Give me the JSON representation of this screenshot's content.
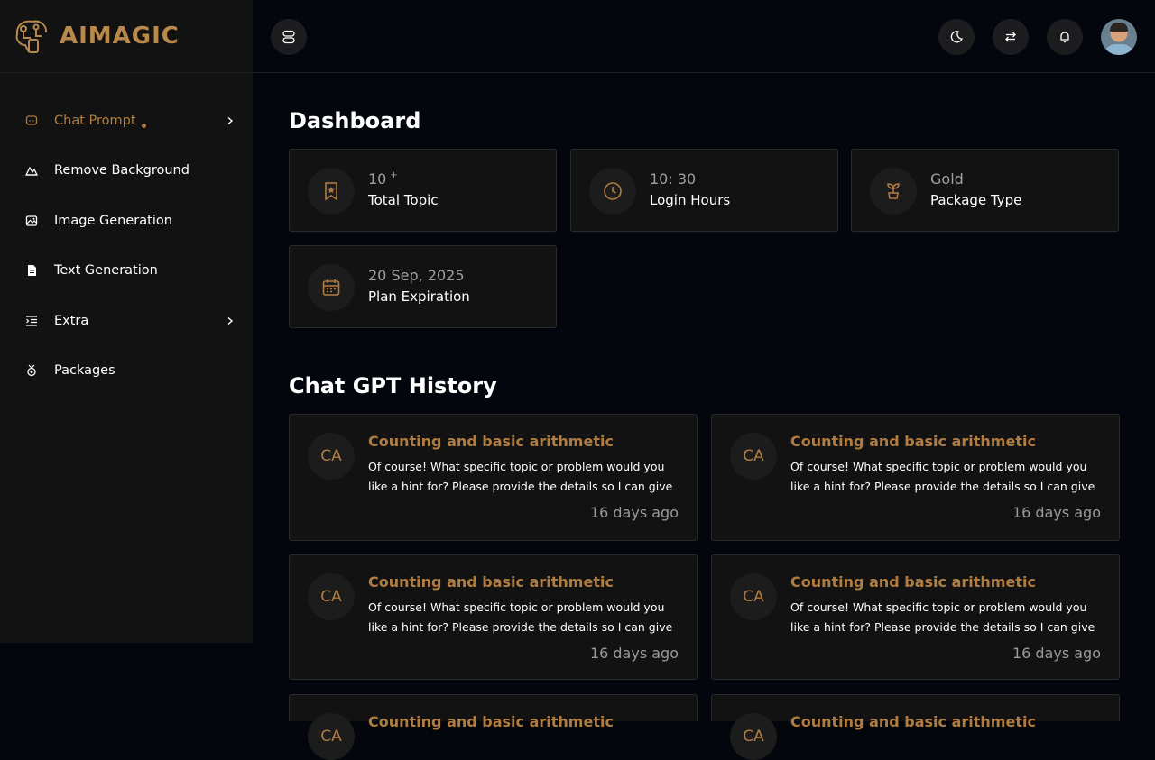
{
  "brand": {
    "logo_text": "AIMAGIC",
    "accent_color": "#b07c40"
  },
  "sidebar": {
    "items": [
      {
        "label": "Chat Prompt",
        "icon": "chat-icon",
        "active": true,
        "has_children": true
      },
      {
        "label": "Remove Background",
        "icon": "mountain-icon",
        "active": false,
        "has_children": false
      },
      {
        "label": "Image Generation",
        "icon": "image-icon",
        "active": false,
        "has_children": false
      },
      {
        "label": "Text Generation",
        "icon": "document-icon",
        "active": false,
        "has_children": false
      },
      {
        "label": "Extra",
        "icon": "list-indent-icon",
        "active": false,
        "has_children": true
      },
      {
        "label": "Packages",
        "icon": "medal-icon",
        "active": false,
        "has_children": false
      }
    ]
  },
  "topbar": {
    "buttons": [
      "menu-toggle-icon",
      "moon-icon",
      "swap-icon",
      "bell-icon"
    ]
  },
  "dashboard": {
    "title": "Dashboard",
    "stats": [
      {
        "value": "10",
        "suffix": "+",
        "label": "Total Topic",
        "icon": "bookmark-star-icon"
      },
      {
        "value": "10: 30",
        "suffix": "",
        "label": "Login Hours",
        "icon": "clock-icon"
      },
      {
        "value": "Gold",
        "suffix": "",
        "label": "Package Type",
        "icon": "plant-icon"
      },
      {
        "value": "20 Sep, 2025",
        "suffix": "",
        "label": "Plan Expiration",
        "icon": "calendar-icon"
      }
    ]
  },
  "history": {
    "title": "Chat GPT History",
    "items": [
      {
        "initials": "CA",
        "title": "Counting and basic arithmetic",
        "text": "Of course! What specific topic or problem would you like a hint for? Please provide the details so I can give you",
        "time": "16 days ago"
      },
      {
        "initials": "CA",
        "title": "Counting and basic arithmetic",
        "text": "Of course! What specific topic or problem would you like a hint for? Please provide the details so I can give you",
        "time": "16 days ago"
      },
      {
        "initials": "CA",
        "title": "Counting and basic arithmetic",
        "text": "Of course! What specific topic or problem would you like a hint for? Please provide the details so I can give you",
        "time": "16 days ago"
      },
      {
        "initials": "CA",
        "title": "Counting and basic arithmetic",
        "text": "Of course! What specific topic or problem would you like a hint for? Please provide the details so I can give you",
        "time": "16 days ago"
      },
      {
        "initials": "CA",
        "title": "Counting and basic arithmetic",
        "text": "",
        "time": ""
      },
      {
        "initials": "CA",
        "title": "Counting and basic arithmetic",
        "text": "",
        "time": ""
      }
    ]
  }
}
